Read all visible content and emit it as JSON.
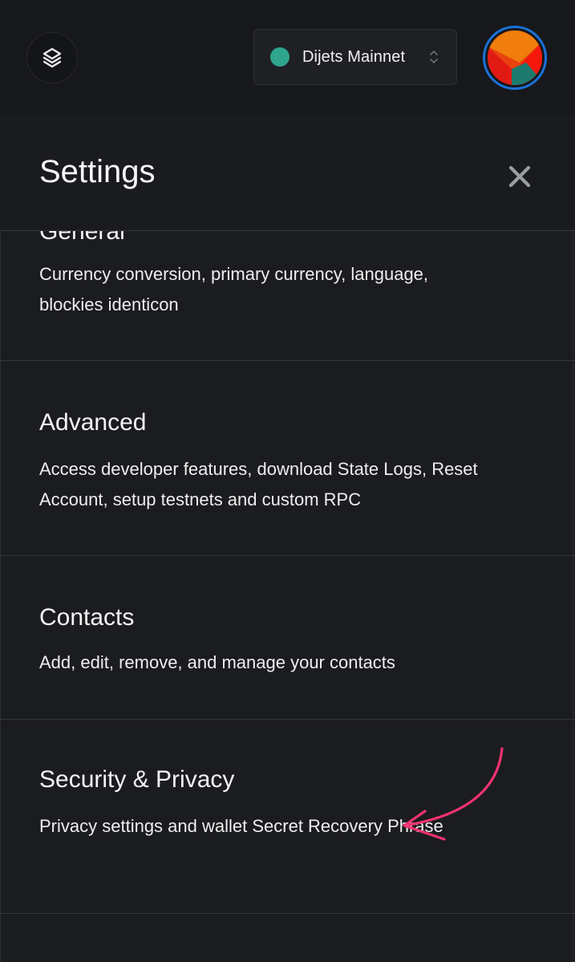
{
  "header": {
    "network_name": "Dijets Mainnet",
    "network_status_color": "#2ea58c"
  },
  "settings": {
    "title": "Settings",
    "items": [
      {
        "title": "General",
        "description": "Currency conversion, primary currency, language, blockies identicon"
      },
      {
        "title": "Advanced",
        "description": "Access developer features, download State Logs, Reset Account, setup testnets and custom RPC"
      },
      {
        "title": "Contacts",
        "description": "Add, edit, remove, and manage your contacts"
      },
      {
        "title": "Security & Privacy",
        "description": "Privacy settings and wallet Secret Recovery Phrase"
      }
    ]
  },
  "icons": {
    "logo": "layers-logo-icon",
    "network_dropdown": "chevron-up-down-icon",
    "close": "close-icon",
    "annotation": "arrow-annotation-icon"
  },
  "colors": {
    "background": "#1b1c1f",
    "annotation_arrow": "#f0326e",
    "avatar_ring": "#1a72d9"
  }
}
